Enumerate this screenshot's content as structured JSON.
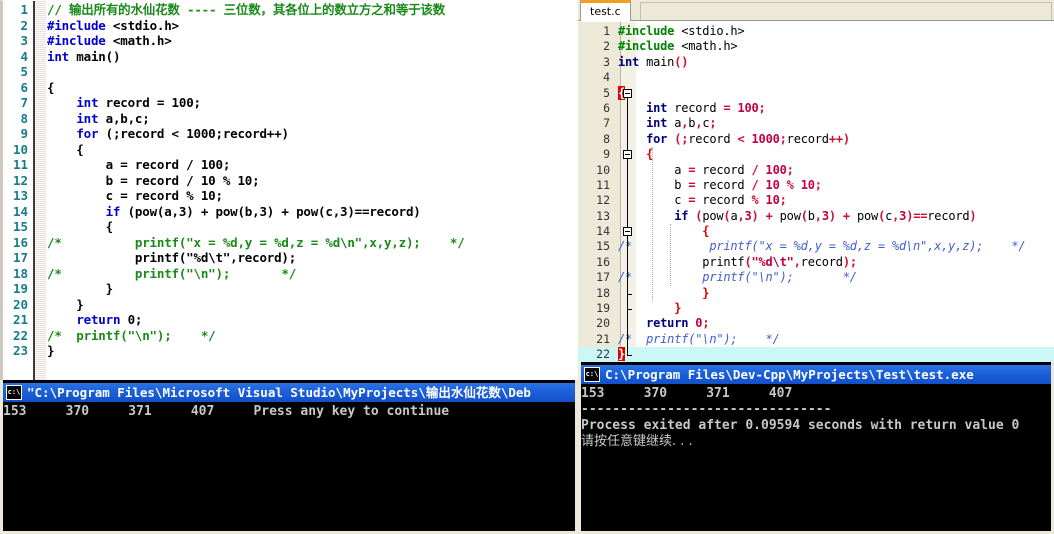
{
  "vc_editor": {
    "name": "visual-studio-editor",
    "line_number_color": "#147d8c",
    "comment_color": "#1a8a1a",
    "keyword_color": "#0000d0",
    "lines": [
      {
        "n": "1",
        "html": "<span class='cm'>// 输出所有的水仙花数 ---- 三位数，其各位上的数立方之和等于该数</span>"
      },
      {
        "n": "2",
        "html": "<span class='pp'>#include</span> &lt;stdio.h&gt;"
      },
      {
        "n": "3",
        "html": "<span class='pp'>#include</span> &lt;math.h&gt;"
      },
      {
        "n": "4",
        "html": "<span class='kw'>int</span> main()"
      },
      {
        "n": "5",
        "html": ""
      },
      {
        "n": "6",
        "html": "{"
      },
      {
        "n": "7",
        "html": "    <span class='kw'>int</span> record = 100;"
      },
      {
        "n": "8",
        "html": "    <span class='kw'>int</span> a,b,c;"
      },
      {
        "n": "9",
        "html": "    <span class='kw'>for</span> (;record &lt; 1000;record++)"
      },
      {
        "n": "10",
        "html": "    {"
      },
      {
        "n": "11",
        "html": "        a = record / 100;"
      },
      {
        "n": "12",
        "html": "        b = record / 10 % 10;"
      },
      {
        "n": "13",
        "html": "        c = record % 10;"
      },
      {
        "n": "14",
        "html": "        <span class='kw'>if</span> (pow(a,3) + pow(b,3) + pow(c,3)==record)"
      },
      {
        "n": "15",
        "html": "        {"
      },
      {
        "n": "16",
        "html": "<span class='cm'>/*          printf(\"x = %d,y = %d,z = %d\\n\",x,y,z);    */</span>"
      },
      {
        "n": "17",
        "html": "            printf(\"%d\\t\",record);"
      },
      {
        "n": "18",
        "html": "<span class='cm'>/*          printf(\"\\n\");       */</span>"
      },
      {
        "n": "19",
        "html": "        }"
      },
      {
        "n": "20",
        "html": "    }"
      },
      {
        "n": "21",
        "html": "    <span class='kw'>return</span> 0;"
      },
      {
        "n": "22",
        "html": "<span class='cm'>/*  printf(\"\\n\");    */</span>"
      },
      {
        "n": "23",
        "html": "}"
      }
    ]
  },
  "dev_editor": {
    "name": "dev-cpp-editor",
    "tab_label": "test.c",
    "active_tab_accent": "#f0a020",
    "current_line": 22,
    "lines": [
      {
        "n": "1",
        "html": "<span class='pp'>#include</span> &lt;stdio.h&gt;"
      },
      {
        "n": "2",
        "html": "<span class='pp'>#include</span> &lt;math.h&gt;"
      },
      {
        "n": "3",
        "html": "<span class='kw'>int</span> main<span class='op'>()</span>"
      },
      {
        "n": "4",
        "html": ""
      },
      {
        "n": "5",
        "html": "<span class='brc'>{</span>"
      },
      {
        "n": "6",
        "html": "    <span class='kw'>int</span> record <span class='op'>=</span> <span class='num'>100</span><span class='op'>;</span>"
      },
      {
        "n": "7",
        "html": "    <span class='kw'>int</span> a<span class='op'>,</span>b<span class='op'>,</span>c<span class='op'>;</span>"
      },
      {
        "n": "8",
        "html": "    <span class='kw'>for</span> <span class='op'>(;</span>record <span class='op'>&lt;</span> <span class='num'>1000</span><span class='op'>;</span>record<span class='op'>++)</span>"
      },
      {
        "n": "9",
        "html": "    <span class='brc2'>{</span>"
      },
      {
        "n": "10",
        "html": "        a <span class='op'>=</span> record <span class='op'>/</span> <span class='num'>100</span><span class='op'>;</span>"
      },
      {
        "n": "11",
        "html": "        b <span class='op'>=</span> record <span class='op'>/</span> <span class='num'>10</span> <span class='op'>%</span> <span class='num'>10</span><span class='op'>;</span>"
      },
      {
        "n": "12",
        "html": "        c <span class='op'>=</span> record <span class='op'>%</span> <span class='num'>10</span><span class='op'>;</span>"
      },
      {
        "n": "13",
        "html": "        <span class='kw'>if</span> <span class='op'>(</span>pow<span class='op'>(</span>a<span class='op'>,</span><span class='num'>3</span><span class='op'>)</span> <span class='op'>+</span> pow<span class='op'>(</span>b<span class='op'>,</span><span class='num'>3</span><span class='op'>)</span> <span class='op'>+</span> pow<span class='op'>(</span>c<span class='op'>,</span><span class='num'>3</span><span class='op'>)==</span>record<span class='op'>)</span>"
      },
      {
        "n": "14",
        "html": "            <span class='brc2'>{</span>"
      },
      {
        "n": "15",
        "html": "<span class='cm'>/*           printf(\"x = %d,y = %d,z = %d\\n\",x,y,z);    */</span>"
      },
      {
        "n": "16",
        "html": "            printf<span class='op'>(</span><span class='str'>\"%d\\t\"</span><span class='op'>,</span>record<span class='op'>);</span>"
      },
      {
        "n": "17",
        "html": "<span class='cm'>/*          printf(\"\\n\");       */</span>"
      },
      {
        "n": "18",
        "html": "            <span class='brc2'>}</span>"
      },
      {
        "n": "19",
        "html": "        <span class='brc2'>}</span>"
      },
      {
        "n": "20",
        "html": "    <span class='kw'>return</span> <span class='num'>0</span><span class='op'>;</span>"
      },
      {
        "n": "21",
        "html": "<span class='cm'>/*  printf(\"\\n\");    */</span>"
      },
      {
        "n": "22",
        "html": "<span class='brc'>}</span>"
      }
    ]
  },
  "vc_console": {
    "name": "visual-studio-console",
    "title": "\"C:\\Program Files\\Microsoft Visual Studio\\MyProjects\\输出水仙花数\\Deb",
    "icon": "console-icon",
    "output": "153     370     371     407     Press any key to continue"
  },
  "dev_console": {
    "name": "dev-cpp-console",
    "title": "C:\\Program Files\\Dev-Cpp\\MyProjects\\Test\\test.exe",
    "icon": "console-icon",
    "line1": "153     370     371     407",
    "line2": "--------------------------------",
    "line3": "Process exited after 0.09594 seconds with return value 0",
    "line4": "请按任意键继续. . ."
  }
}
